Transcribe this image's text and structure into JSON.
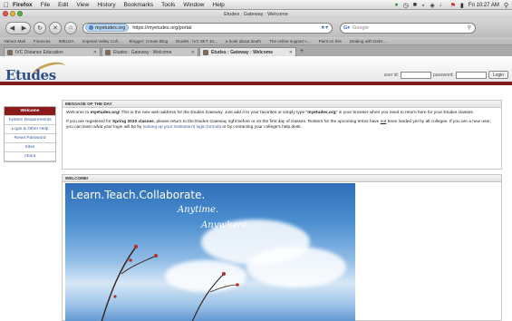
{
  "menubar": {
    "app": "Firefox",
    "items": [
      "File",
      "Edit",
      "View",
      "History",
      "Bookmarks",
      "Tools",
      "Window",
      "Help"
    ],
    "clock": "Fri 10:27 AM"
  },
  "window": {
    "title": "Etudes : Gateway : Welcome"
  },
  "navbar": {
    "site_badge": "myetudes.org",
    "url": "https://myetudes.org/portal",
    "search_placeholder": "Google"
  },
  "bookmarks": [
    "Yahoo! Mail",
    "Finances",
    "IMELDA",
    "Imperial Valley Coll...",
    "Blogger: Create Blog",
    "Etudes : IVC 6KT 10...",
    "a book about death",
    "The online support c...",
    "Paint on this",
    "Dealing with Debt ..."
  ],
  "tabs": [
    {
      "label": "IVC Distance Education",
      "active": false
    },
    {
      "label": "Etudes : Gateway : Welcome",
      "active": false
    },
    {
      "label": "Etudes : Gateway : Welcome",
      "active": true
    }
  ],
  "header": {
    "logo": "Etudes",
    "user_id_label": "user id:",
    "password_label": "password:",
    "login_button": "Login"
  },
  "sidebar": {
    "items": [
      {
        "label": "Welcome",
        "active": true
      },
      {
        "label": "System Requirements",
        "active": false
      },
      {
        "label": "Login & Other Help",
        "active": false
      },
      {
        "label": "Reset Password",
        "active": false
      },
      {
        "label": "Sites",
        "active": false
      },
      {
        "label": "About",
        "active": false
      }
    ]
  },
  "motd": {
    "heading": "MESSAGE OF THE DAY",
    "p1_a": "Welcome to ",
    "p1_b": "myetudes.org",
    "p1_c": "! This is the new web address for the Etudes Gateway. Just add it to your favorites or simply type \"",
    "p1_d": "myetudes.org",
    "p1_e": "\" in your browser when you need to return here for your Etudes classes.",
    "p2_a": "If you are registered for ",
    "p2_b": "Spring 2010 classes",
    "p2_c": ", please return to the Etudes Gateway right before or on the first day of classes. Rosters for the upcoming terms have ",
    "p2_d": "not",
    "p2_e": " been loaded yet by all colleges. If you are a new user, you can learn what your login will be by ",
    "p2_f": "looking up your institution's login formula",
    "p2_g": " or by contacting your college's help desk."
  },
  "welcome": {
    "heading": "WELCOME!",
    "tagline": "Learn.Teach.Collaborate.",
    "anytime": "Anytime.",
    "anywhere": "Anywhere..."
  }
}
